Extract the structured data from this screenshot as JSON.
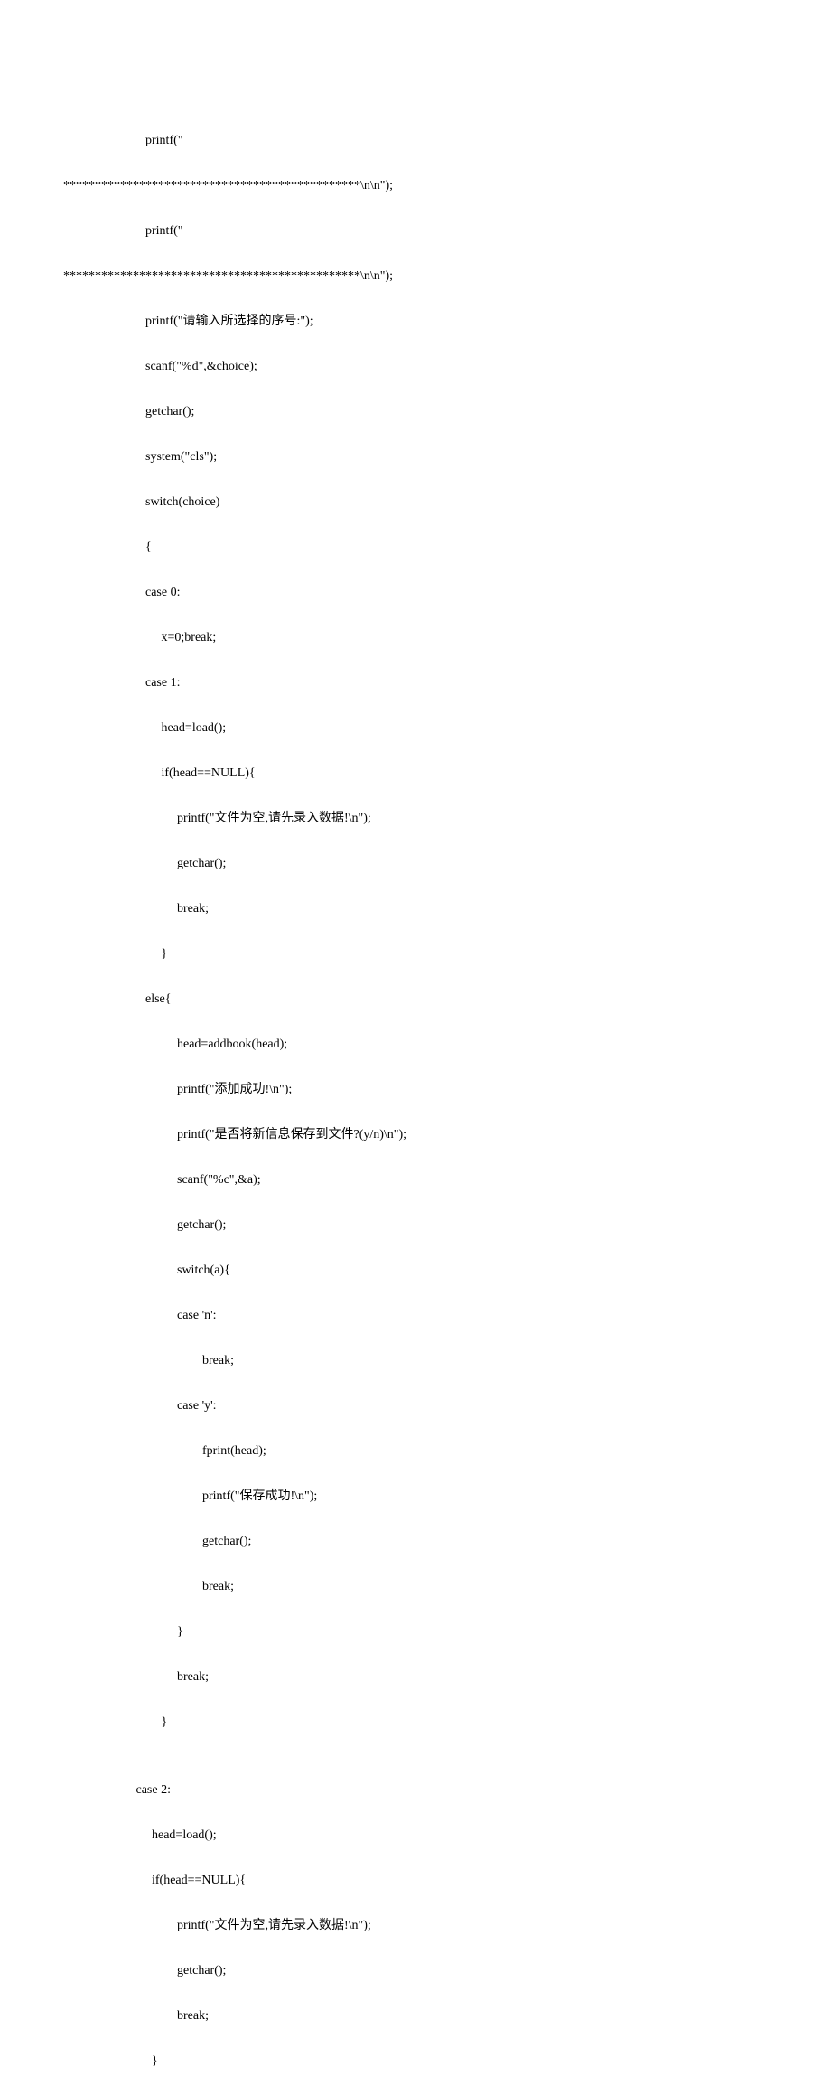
{
  "code": {
    "indent": {
      "base": "                                              ",
      "l0": "                    ",
      "l1": "                          ",
      "l2": "                               ",
      "l3": "                                    ",
      "l4": "                                          ",
      "l5": "                                                "
    },
    "lines": [
      "                                              printf(\"",
      "                    ***********************************************\\n\\n\");",
      "                                              printf(\"",
      "                    ***********************************************\\n\\n\");",
      "                                              printf(\"请输入所选择的序号:\");",
      "                                              scanf(\"%d\",&choice);",
      "                                              getchar();",
      "                                              system(\"cls\");",
      "                                              switch(choice)",
      "                                              {",
      "                                              case 0:",
      "                                                   x=0;break;",
      "                                              case 1:",
      "                                                   head=load();",
      "                                                   if(head==NULL){",
      "                                                        printf(\"文件为空,请先录入数据!\\n\");",
      "                                                        getchar();",
      "                                                        break;",
      "                                                   }",
      "                                              else{",
      "                                                        head=addbook(head);",
      "                                                        printf(\"添加成功!\\n\");",
      "                                                        printf(\"是否将新信息保存到文件?(y/n)\\n\");",
      "                                                        scanf(\"%c\",&a);",
      "                                                        getchar();",
      "                                                        switch(a){",
      "                                                        case 'n':",
      "                                                                break;",
      "                                                        case 'y':",
      "                                                                fprint(head);",
      "                                                                printf(\"保存成功!\\n\");",
      "                                                                getchar();",
      "                                                                break;",
      "                                                        }",
      "                                                        break;",
      "                                                   }",
      "",
      "                                           case 2:",
      "                                                head=load();",
      "                                                if(head==NULL){",
      "                                                        printf(\"文件为空,请先录入数据!\\n\");",
      "                                                        getchar();",
      "                                                        break;",
      "                                                }"
    ]
  }
}
